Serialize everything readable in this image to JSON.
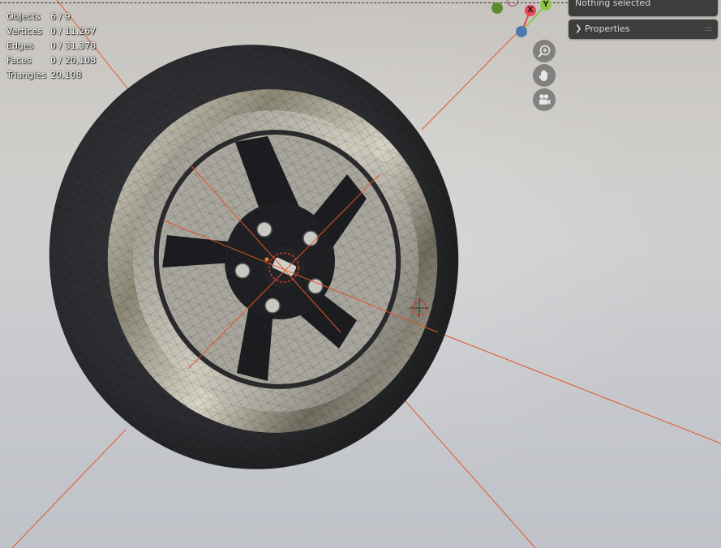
{
  "stats": [
    {
      "label": "Objects",
      "value": "6 / 9"
    },
    {
      "label": "Vertices",
      "value": "0 / 11,267"
    },
    {
      "label": "Edges",
      "value": "0 / 31,378"
    },
    {
      "label": "Faces",
      "value": "0 / 20,108"
    },
    {
      "label": "Triangles",
      "value": "20,108"
    }
  ],
  "gizmo": {
    "x_label": "X",
    "y_label": "Y",
    "colors": {
      "x": "#e84557",
      "y": "#8bc541",
      "z": "#4d79b0",
      "neg_x": "#b04553",
      "neg_y": "#5f8b2f"
    }
  },
  "nav_buttons": [
    {
      "name": "zoom-icon"
    },
    {
      "name": "hand-pan-icon"
    },
    {
      "name": "camera-icon"
    }
  ],
  "sidebar": {
    "status": "Nothing selected",
    "panel_label": "Properties",
    "panel_icon": "chevron-right-icon"
  },
  "colors": {
    "axis_line": "#e0572b",
    "panel_bg": "#3d3d3d",
    "tire": "#2b2c2e",
    "spoke": "#1c1d20"
  }
}
